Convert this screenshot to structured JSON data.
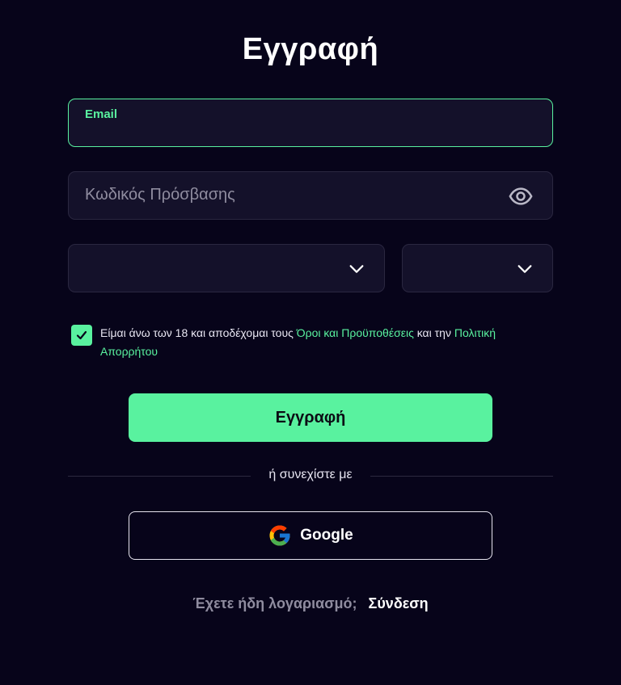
{
  "form": {
    "title": "Εγγραφή",
    "email_label": "Email",
    "email_value": "",
    "password_placeholder": "Κωδικός Πρόσβασης"
  },
  "terms": {
    "checked": true,
    "text_prefix": "Είμαι άνω των 18 και αποδέχομαι τους ",
    "terms_link": "Όροι και Προϋποθέσεις",
    "text_middle": " και την ",
    "privacy_link": "Πολιτική Απορρήτου"
  },
  "actions": {
    "register_label": "Εγγραφή",
    "divider_text": "ή συνεχίστε με",
    "google_label": "Google"
  },
  "footer": {
    "question": "Έχετε ήδη λογαριασμό;",
    "login_link": "Σύνδεση"
  },
  "icons": {
    "password_toggle": "eye-icon",
    "select_arrow": "chevron-down-icon",
    "checkbox_mark": "checkmark-icon",
    "google": "google-logo-icon"
  },
  "colors": {
    "background": "#07041a",
    "field_background": "#14112a",
    "accent": "#59f29f",
    "muted_text": "#8f8c9f"
  }
}
